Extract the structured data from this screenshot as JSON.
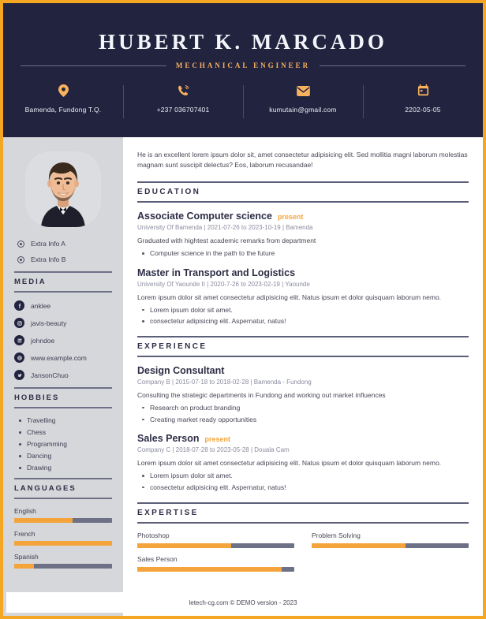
{
  "theme": {
    "frame_color": "#f5a623",
    "header_bg": "#22233f",
    "accent": "#f5a43c",
    "sidebar_bg": "#d6d7da",
    "muted_text": "#8b8da0",
    "bar_track": "#6e7086"
  },
  "header": {
    "name": "HUBERT K. MARCADO",
    "job_title": "MECHANICAL ENGINEER",
    "contacts": [
      {
        "icon": "location-pin-icon",
        "value": "Bamenda, Fundong T.Q."
      },
      {
        "icon": "phone-icon",
        "value": "+237 036707401"
      },
      {
        "icon": "envelope-icon",
        "value": "kumutain@gmail.com"
      },
      {
        "icon": "calendar-icon",
        "value": "2202-05-05"
      }
    ]
  },
  "sidebar": {
    "avatar_alt": "profile-photo",
    "extra_info": [
      {
        "label": "Extra Info A"
      },
      {
        "label": "Extra Info B"
      }
    ],
    "media": {
      "heading": "MEDIA",
      "items": [
        {
          "icon": "facebook-icon",
          "label": "anklee"
        },
        {
          "icon": "instagram-icon",
          "label": "javis-beauty"
        },
        {
          "icon": "linkedin-icon",
          "label": "johndoe"
        },
        {
          "icon": "globe-icon",
          "label": "www.example.com"
        },
        {
          "icon": "twitter-icon",
          "label": "JansonChuo"
        }
      ]
    },
    "hobbies": {
      "heading": "HOBBIES",
      "items": [
        "Travelling",
        "Chess",
        "Programming",
        "Dancing",
        "Drawing"
      ]
    },
    "languages": {
      "heading": "LANGUAGES",
      "items": [
        {
          "label": "English",
          "level": 60
        },
        {
          "label": "French",
          "level": 100
        },
        {
          "label": "Spanish",
          "level": 20
        }
      ]
    }
  },
  "main": {
    "summary": "He is an excellent lorem ipsum dolor sit, amet consectetur adipisicing elit. Sed mollitia magni laborum molestias magnam sunt suscipit delectus? Eos, laborum recusandae!",
    "education": {
      "heading": "EDUCATION",
      "entries": [
        {
          "title": "Associate Computer science",
          "badge": "present",
          "meta": "University Of Bamenda | 2021-07-26 to 2023-10-19 | Bamenda",
          "desc": "Graduated with hightest academic remarks from department",
          "bullets": [
            "Computer science in the path to the future"
          ]
        },
        {
          "title": "Master in Transport and Logistics",
          "badge": "",
          "meta": "University Of Yaounde II | 2020-7-26 to 2023-02-19 | Yaounde",
          "desc": "Lorem ipsum dolor sit amet consectetur adipisicing elit. Natus ipsum et dolor quisquam laborum nemo.",
          "bullets": [
            "Lorem ipsum dolor sit amet.",
            "consectetur adipisicing elit. Aspernatur, natus!"
          ]
        }
      ]
    },
    "experience": {
      "heading": "EXPERIENCE",
      "entries": [
        {
          "title": "Design Consultant",
          "badge": "",
          "meta": "Company B | 2015-07-18 to 2018-02-28 | Bamenda - Fundong",
          "desc": "Consulting the strategic departments in Fundong and working out market influences",
          "bullets": [
            "Research on product branding",
            "Creating market ready opportunities"
          ]
        },
        {
          "title": "Sales Person",
          "badge": "present",
          "meta": "Company C | 2018-07-28 to 2023-05-28 | Douala Cam",
          "desc": "Lorem ipsum dolor sit amet consectetur adipisicing elit. Natus ipsum et dolor quisquam laborum nemo.",
          "bullets": [
            "Lorem ipsum dolor sit amet.",
            "consectetur adipisicing elit. Aspernatur, natus!"
          ]
        }
      ]
    },
    "expertise": {
      "heading": "EXPERTISE",
      "skills": [
        {
          "label": "Photoshop",
          "level": 60
        },
        {
          "label": "Problem Solving",
          "level": 60
        },
        {
          "label": "Sales Person",
          "level": 92
        }
      ]
    }
  },
  "footer": {
    "text": "letech-cg.com © DEMO version - 2023"
  }
}
